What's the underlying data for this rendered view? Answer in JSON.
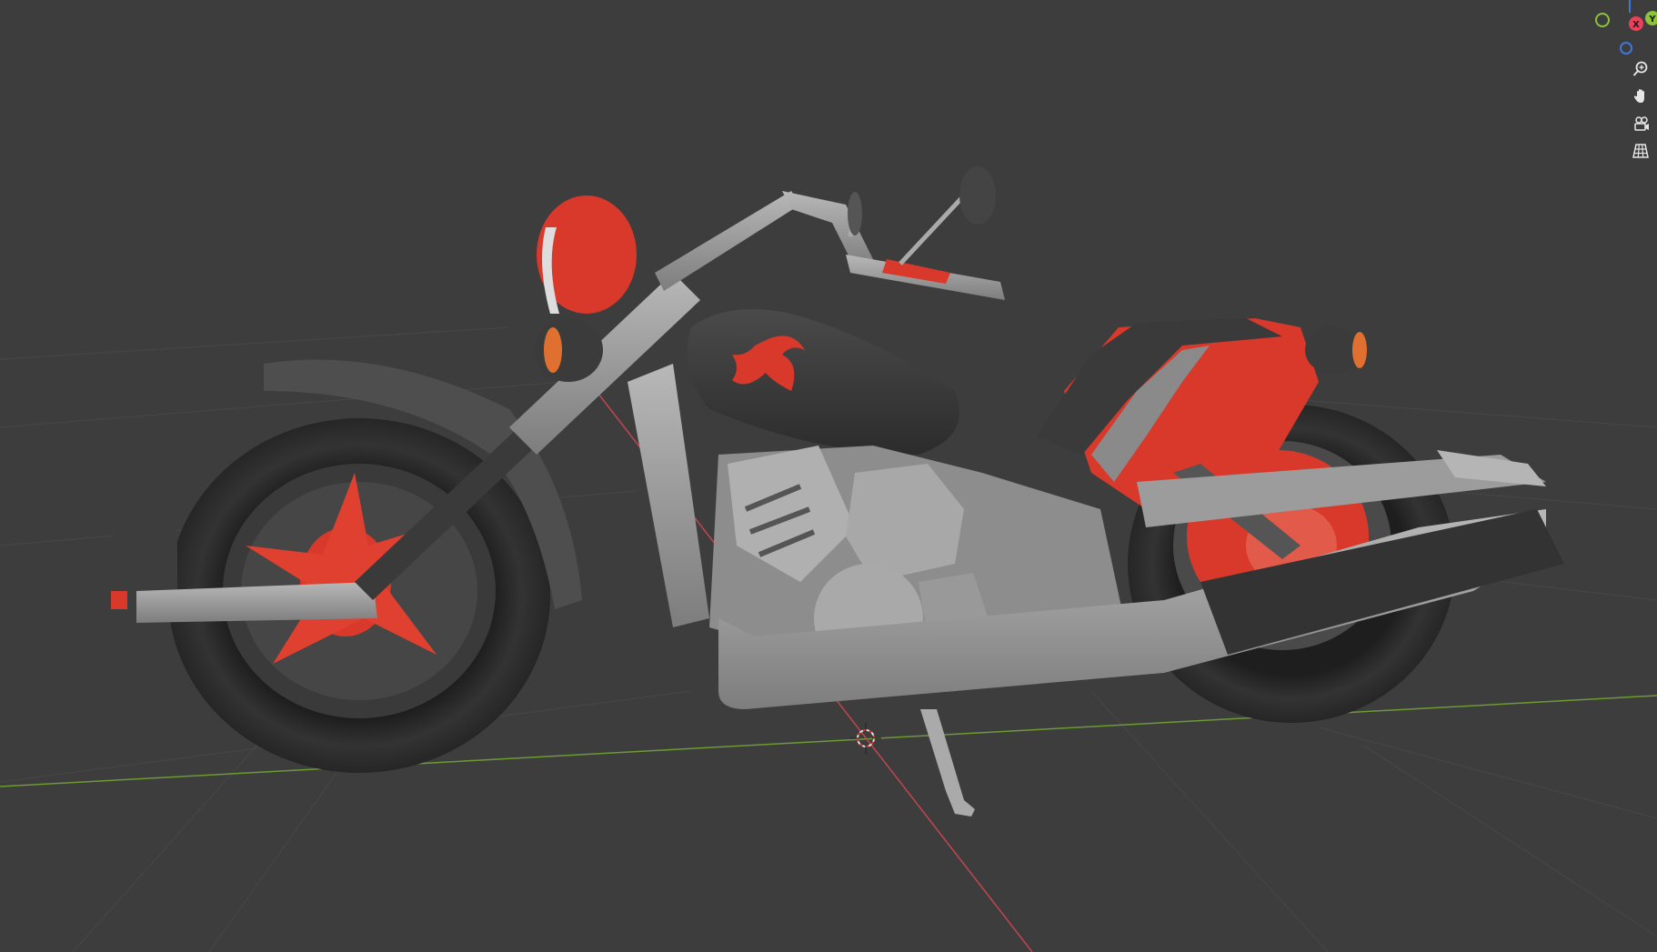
{
  "app": {
    "view_mode": "3D Viewport"
  },
  "gizmo": {
    "x_label": "X",
    "y_label": "Y",
    "colors": {
      "x": "#e8415a",
      "y": "#8bc43a",
      "z": "#3f77d6"
    }
  },
  "nav_tools": [
    {
      "name": "zoom-icon"
    },
    {
      "name": "pan-hand-icon"
    },
    {
      "name": "camera-view-icon"
    },
    {
      "name": "ortho-grid-icon"
    }
  ],
  "scene": {
    "object": "motorcycle",
    "colors": {
      "background": "#3d3d3d",
      "body_red": "#d8392b",
      "metal_gray": "#9a9a9a",
      "tire_black": "#262626",
      "x_axis": "#c24550",
      "y_axis": "#6d9a34"
    }
  }
}
